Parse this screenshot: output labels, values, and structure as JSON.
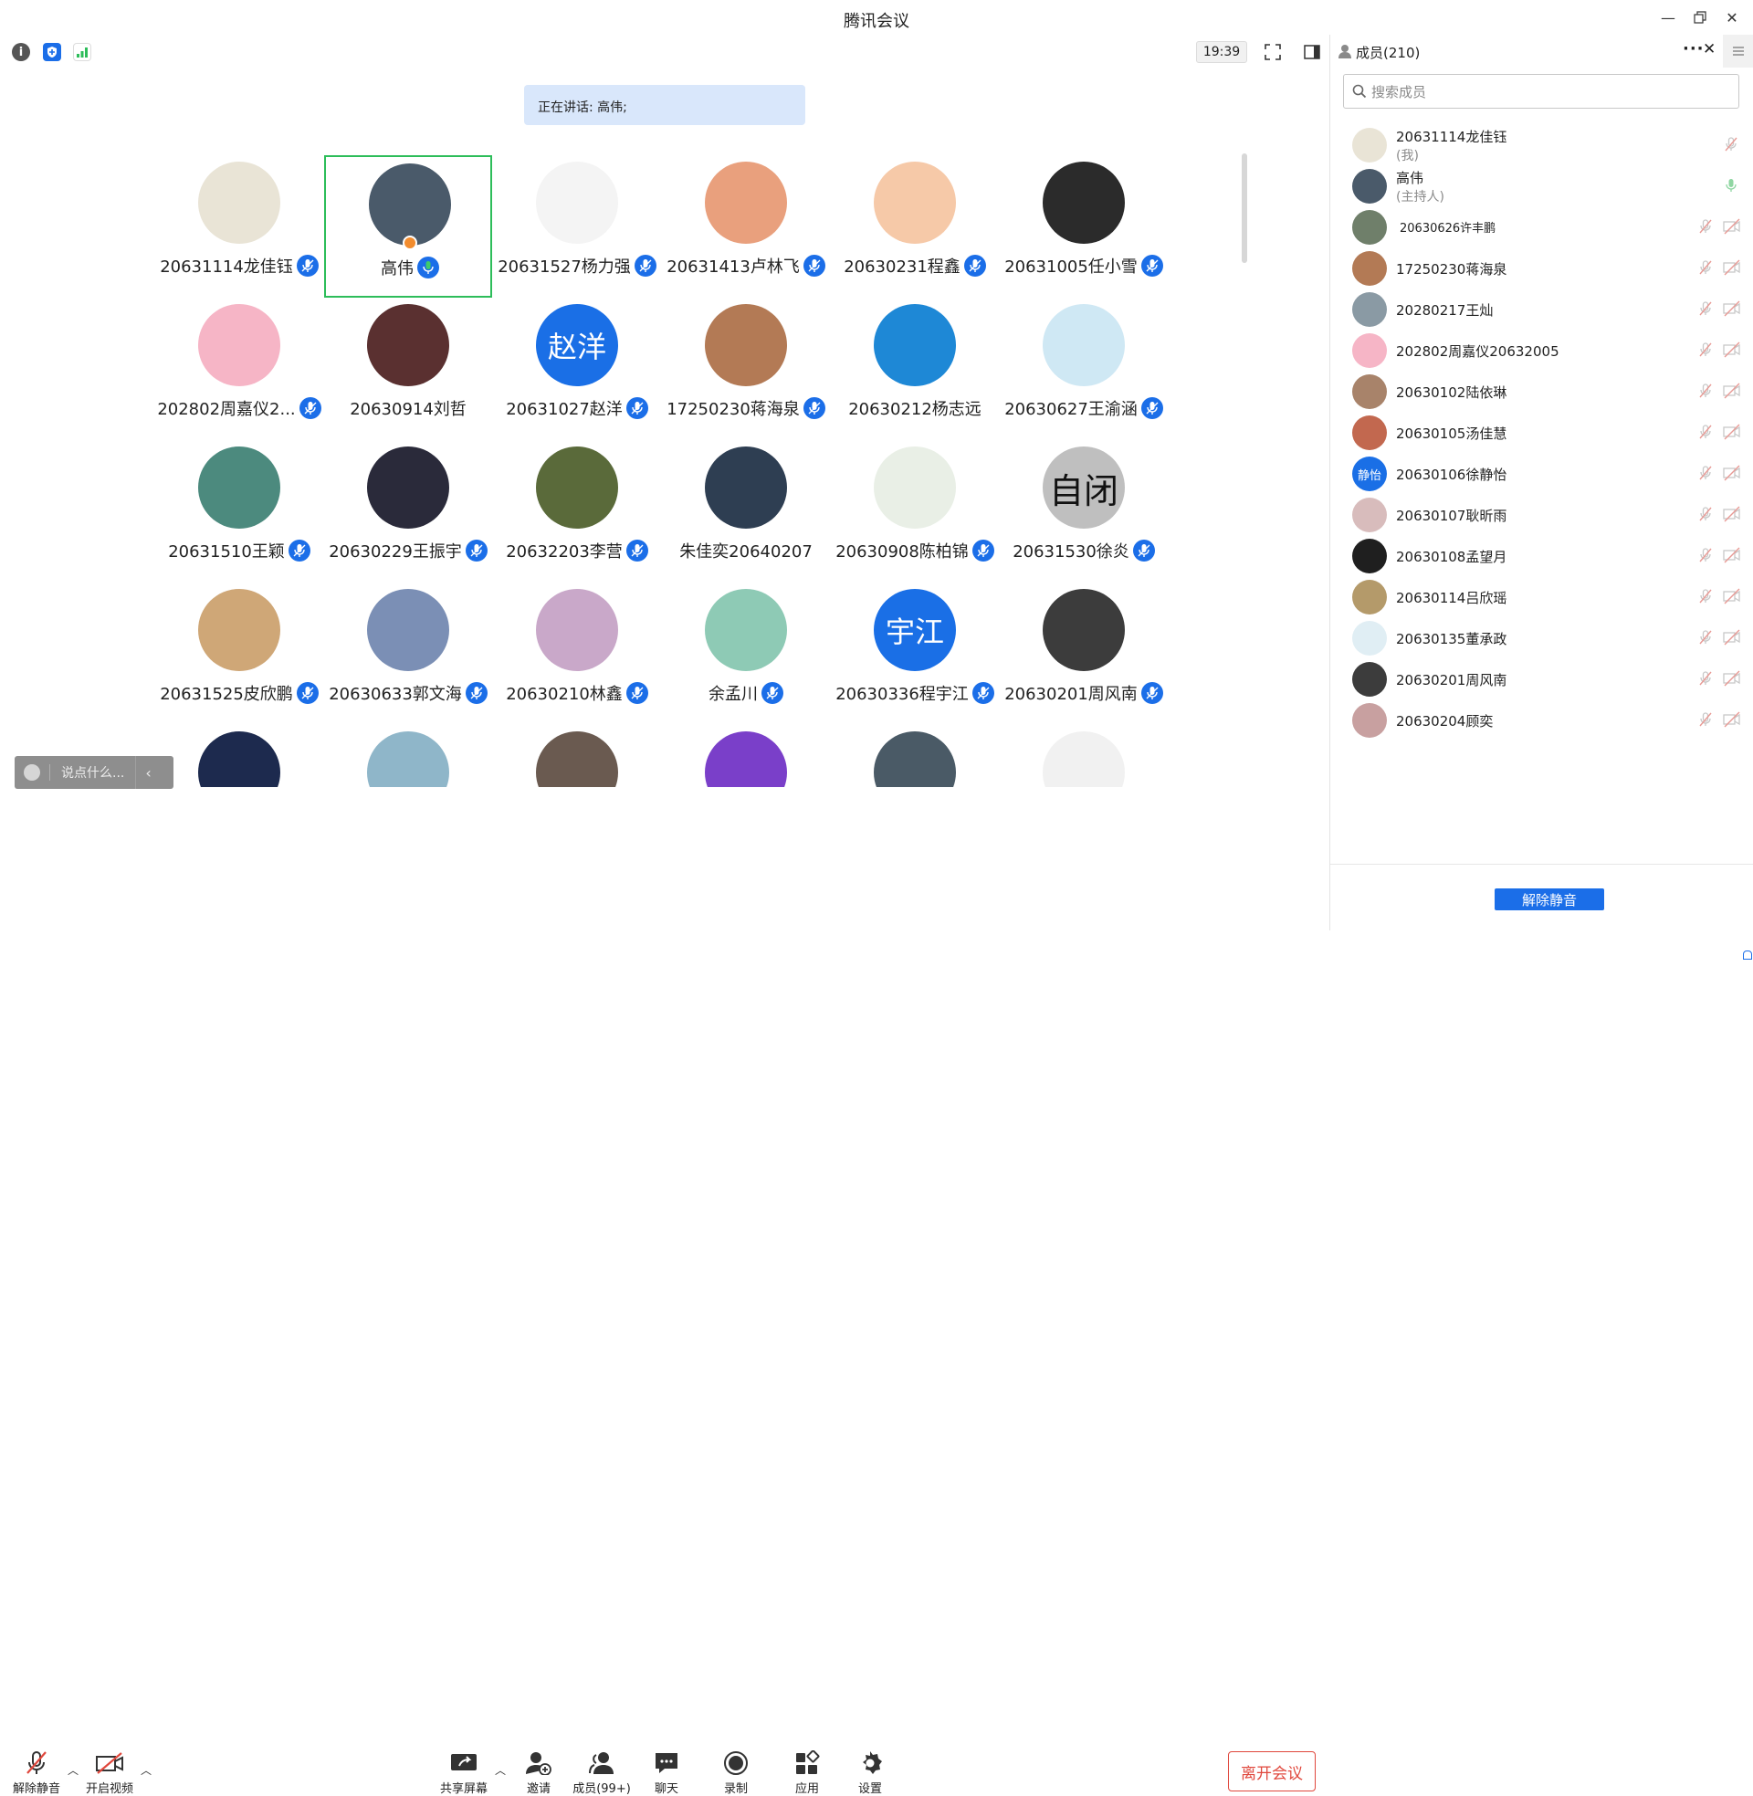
{
  "app": {
    "title": "腾讯会议",
    "clock": "19:39"
  },
  "speaking": "正在讲话: 高伟;",
  "grid": {
    "participants": [
      {
        "name": "20631114龙佳钰",
        "mic": true,
        "color": "#e9e4d6",
        "text": ""
      },
      {
        "name": "高伟",
        "mic": true,
        "color": "#4a5a6a",
        "text": "",
        "active": true,
        "host": true,
        "green": true
      },
      {
        "name": "20631527杨力强",
        "mic": true,
        "color": "#f4f4f4",
        "text": ""
      },
      {
        "name": "20631413卢林飞",
        "mic": true,
        "color": "#e9a07d",
        "text": ""
      },
      {
        "name": "20630231程鑫",
        "mic": true,
        "color": "#f6c9a8",
        "text": ""
      },
      {
        "name": "20631005任小雪",
        "mic": true,
        "color": "#2b2b2b",
        "text": ""
      },
      {
        "name": "202802周嘉仪2...",
        "mic": true,
        "color": "#f6b5c6",
        "text": ""
      },
      {
        "name": "20630914刘哲",
        "mic": false,
        "color": "#5a3030",
        "text": ""
      },
      {
        "name": "20631027赵洋",
        "mic": true,
        "color": "#1a6fe6",
        "text": "赵洋"
      },
      {
        "name": "17250230蒋海泉",
        "mic": true,
        "color": "#b37a55",
        "text": ""
      },
      {
        "name": "20630212杨志远",
        "mic": false,
        "color": "#1e88d6",
        "text": ""
      },
      {
        "name": "20630627王渝涵",
        "mic": true,
        "color": "#cfe8f4",
        "text": ""
      },
      {
        "name": "20631510王颖",
        "mic": true,
        "color": "#4c8a7e",
        "text": ""
      },
      {
        "name": "20630229王振宇",
        "mic": true,
        "color": "#2a2a3a",
        "text": ""
      },
      {
        "name": "20632203李营",
        "mic": true,
        "color": "#5a6a3a",
        "text": ""
      },
      {
        "name": "朱佳奕20640207",
        "mic": false,
        "color": "#2e3e52",
        "text": ""
      },
      {
        "name": "20630908陈柏锦",
        "mic": true,
        "color": "#e9efe6",
        "text": ""
      },
      {
        "name": "20631530徐炎",
        "mic": true,
        "color": "#bfbfbf",
        "text": "自闭"
      },
      {
        "name": "20631525皮欣鹏",
        "mic": true,
        "color": "#cfa777",
        "text": ""
      },
      {
        "name": "20630633郭文海",
        "mic": true,
        "color": "#7b8fb5",
        "text": ""
      },
      {
        "name": "20630210林鑫",
        "mic": true,
        "color": "#c9a8c9",
        "text": ""
      },
      {
        "name": "余孟川",
        "mic": true,
        "color": "#8ecab5",
        "text": ""
      },
      {
        "name": "20630336程宇江",
        "mic": true,
        "color": "#1a6fe6",
        "text": "宇江"
      },
      {
        "name": "20630201周风南",
        "mic": true,
        "color": "#3c3c3c",
        "text": ""
      },
      {
        "name": "",
        "mic": false,
        "color": "#1d2a4e",
        "text": ""
      },
      {
        "name": "",
        "mic": false,
        "color": "#8fb6c9",
        "text": ""
      },
      {
        "name": "",
        "mic": false,
        "color": "#6a5a50",
        "text": ""
      },
      {
        "name": "",
        "mic": false,
        "color": "#7a3fc9",
        "text": ""
      },
      {
        "name": "",
        "mic": false,
        "color": "#4a5a66",
        "text": ""
      },
      {
        "name": "",
        "mic": false,
        "color": "#f1f1f1",
        "text": ""
      }
    ]
  },
  "chat": {
    "placeholder": "说点什么..."
  },
  "toolbar": {
    "unmute": "解除静音",
    "video": "开启视频",
    "share": "共享屏幕",
    "invite": "邀请",
    "members": "成员(99+)",
    "chat": "聊天",
    "record": "录制",
    "apps": "应用",
    "settings": "设置",
    "leave": "离开会议"
  },
  "panel": {
    "title": "成员(210)",
    "search_placeholder": "搜索成员",
    "unmute_all": "解除静音",
    "members": [
      {
        "name": "20631114龙佳钰",
        "sub": "(我)",
        "color": "#e9e4d6",
        "text": "",
        "state": "me"
      },
      {
        "name": "高伟",
        "sub": "(主持人)",
        "color": "#4a5a6a",
        "text": "",
        "state": "host"
      },
      {
        "name": "20630626许丰鹏",
        "sub": "",
        "color": "#6f7f6a",
        "text": "",
        "state": "muted",
        "small": true
      },
      {
        "name": "17250230蒋海泉",
        "sub": "",
        "color": "#b37a55",
        "text": "",
        "state": "muted"
      },
      {
        "name": "20280217王灿",
        "sub": "",
        "color": "#8a9aa4",
        "text": "",
        "state": "muted"
      },
      {
        "name": "202802周嘉仪20632005",
        "sub": "",
        "color": "#f6b5c6",
        "text": "",
        "state": "muted"
      },
      {
        "name": "20630102陆依琳",
        "sub": "",
        "color": "#a8836a",
        "text": "",
        "state": "muted"
      },
      {
        "name": "20630105汤佳慧",
        "sub": "",
        "color": "#c2684f",
        "text": "",
        "state": "muted"
      },
      {
        "name": "20630106徐静怡",
        "sub": "",
        "color": "#1a6fe6",
        "text": "静怡",
        "state": "muted"
      },
      {
        "name": "20630107耿昕雨",
        "sub": "",
        "color": "#d8bcbc",
        "text": "",
        "state": "muted"
      },
      {
        "name": "20630108孟望月",
        "sub": "",
        "color": "#1f1f1f",
        "text": "",
        "state": "muted"
      },
      {
        "name": "20630114吕欣瑶",
        "sub": "",
        "color": "#b49a6a",
        "text": "",
        "state": "muted"
      },
      {
        "name": "20630135董承政",
        "sub": "",
        "color": "#e0eef4",
        "text": "",
        "state": "muted"
      },
      {
        "name": "20630201周风南",
        "sub": "",
        "color": "#3c3c3c",
        "text": "",
        "state": "muted"
      },
      {
        "name": "20630204顾奕",
        "sub": "",
        "color": "#c8a0a0",
        "text": "",
        "state": "muted"
      }
    ]
  },
  "colors": {
    "accent": "#1b6ee8",
    "active": "#2dbd5a",
    "leave": "#e0473c"
  }
}
